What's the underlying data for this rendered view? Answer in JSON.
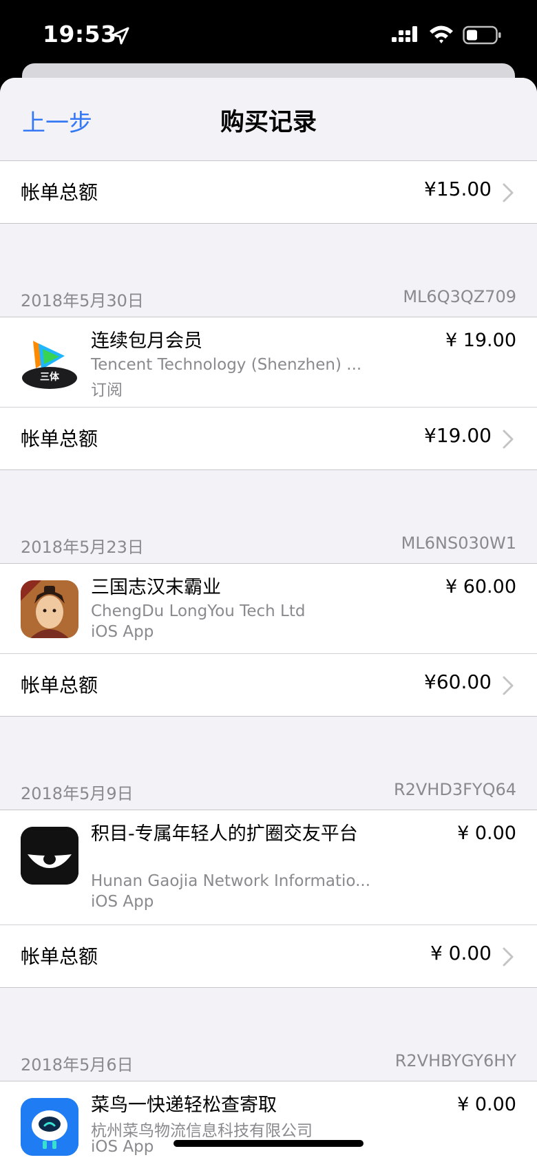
{
  "status_bar": {
    "time": "19:53"
  },
  "nav": {
    "back_label": "上一步",
    "title": "购买记录"
  },
  "first_total": {
    "label": "帐单总额",
    "amount": "¥15.00"
  },
  "sections": [
    {
      "date": "2018年5月30日",
      "order_id": "ML6Q3QZ709",
      "item": {
        "name": "连续包月会员",
        "developer": "Tencent Technology (Shenzhen) ...",
        "type": "订阅",
        "price": "¥ 19.00",
        "icon": "tencent-video-three-body-icon",
        "icon_text": "三体"
      },
      "total": {
        "label": "帐单总额",
        "amount": "¥19.00"
      }
    },
    {
      "date": "2018年5月23日",
      "order_id": "ML6NS030W1",
      "item": {
        "name": "三国志汉末霸业",
        "developer": "ChengDu LongYou Tech Ltd",
        "type": "iOS App",
        "price": "¥ 60.00",
        "icon": "sanguozhi-game-icon"
      },
      "total": {
        "label": "帐单总额",
        "amount": "¥60.00"
      }
    },
    {
      "date": "2018年5月9日",
      "order_id": "R2VHD3FYQ64",
      "item": {
        "name": "积目-专属年轻人的扩圈交友平台",
        "developer": "Hunan Gaojia Network Informatio...",
        "type": "iOS App",
        "price": "¥ 0.00",
        "icon": "jimu-app-icon"
      },
      "total": {
        "label": "帐单总额",
        "amount": "¥ 0.00"
      }
    },
    {
      "date": "2018年5月6日",
      "order_id": "R2VHBYGY6HY",
      "item": {
        "name": "菜鸟一快递轻松查寄取",
        "developer": "杭州菜鸟物流信息科技有限公司",
        "type": "iOS App",
        "price": "¥ 0.00",
        "icon": "cainiao-app-icon"
      }
    }
  ],
  "colors": {
    "accent": "#3478f6",
    "secondary_text": "#8a8a8e",
    "background": "#f2f2f7",
    "separator": "#c6c6c8"
  }
}
